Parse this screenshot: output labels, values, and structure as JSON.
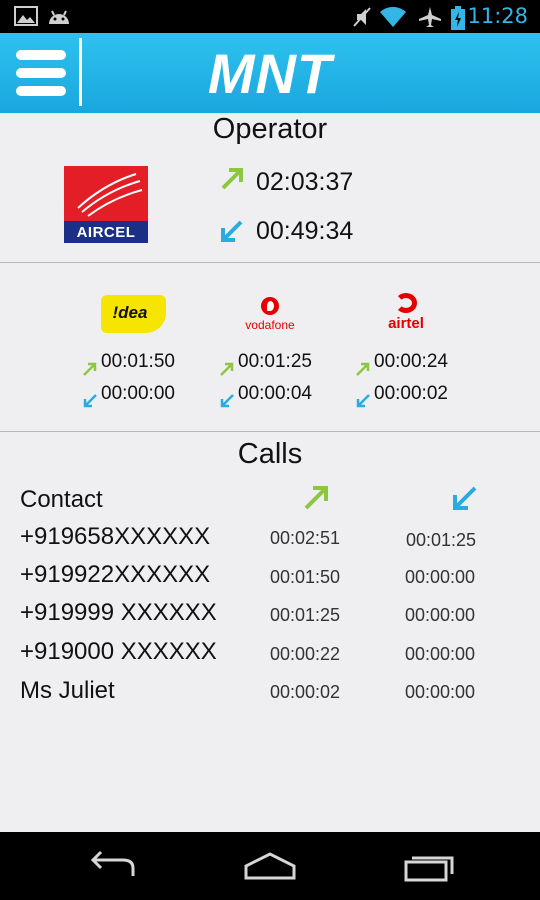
{
  "status_bar": {
    "time": "11:28",
    "icons": [
      "gallery-icon",
      "android-icon",
      "mute-icon",
      "wifi-icon",
      "airplane-icon",
      "battery-icon"
    ]
  },
  "app_bar": {
    "title": "MNT",
    "color": "#1fb0e6"
  },
  "operator": {
    "heading": "Operator",
    "logo_text": "AIRCEL",
    "outgoing": "02:03:37",
    "incoming": "00:49:34"
  },
  "others": [
    {
      "name": "idea",
      "logo_text": "!dea",
      "outgoing": "00:01:50",
      "incoming": "00:00:00"
    },
    {
      "name": "vodafone",
      "logo_text": "vodafone",
      "outgoing": "00:01:25",
      "incoming": "00:00:04"
    },
    {
      "name": "airtel",
      "logo_text": "airtel",
      "outgoing": "00:00:24",
      "incoming": "00:00:02"
    }
  ],
  "calls": {
    "heading": "Calls",
    "contact_header": "Contact",
    "rows": [
      {
        "contact": "+919658XXXXXX",
        "outgoing": "00:02:51",
        "incoming": "00:01:25"
      },
      {
        "contact": "+919922XXXXXX",
        "outgoing": "00:01:50",
        "incoming": "00:00:00"
      },
      {
        "contact": "+919999 XXXXXX",
        "outgoing": "00:01:25",
        "incoming": "00:00:00"
      },
      {
        "contact": "+919000 XXXXXX",
        "outgoing": "00:00:22",
        "incoming": "00:00:00"
      },
      {
        "contact": "Ms Juliet",
        "outgoing": "00:00:02",
        "incoming": "00:00:00"
      }
    ]
  },
  "colors": {
    "outgoing_arrow": "#8dc63f",
    "incoming_arrow": "#29abe2",
    "status_accent": "#33b5e5"
  },
  "nav_bar": {
    "buttons": [
      "back-icon",
      "home-icon",
      "recent-apps-icon"
    ]
  }
}
